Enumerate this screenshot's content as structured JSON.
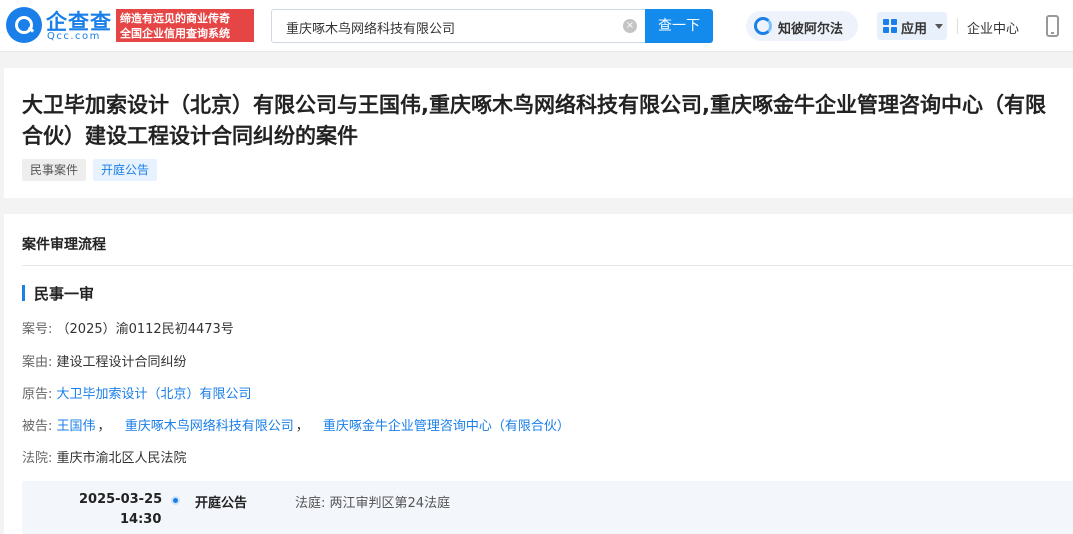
{
  "header": {
    "brand_name": "企查查",
    "brand_domain": "Qcc.com",
    "slogan_line1": "缔造有远见的商业传奇",
    "slogan_line2": "全国企业信用查询系统",
    "search_value": "重庆啄木鸟网络科技有限公司",
    "search_button": "查一下",
    "zhibo_label": "知彼阿尔法",
    "app_label": "应用",
    "enterprise_center": "企业中心",
    "clear_icon_glyph": "×"
  },
  "case": {
    "title": "大卫毕加索设计（北京）有限公司与王国伟,重庆啄木鸟网络科技有限公司,重庆啄金牛企业管理咨询中心（有限合伙）建设工程设计合同纠纷的案件",
    "tags": [
      "民事案件",
      "开庭公告"
    ]
  },
  "process": {
    "section_title": "案件审理流程",
    "stage_title": "民事一审",
    "case_no_label": "案号:",
    "case_no": "（2025）渝0112民初4473号",
    "cause_label": "案由:",
    "cause": "建设工程设计合同纠纷",
    "plaintiff_label": "原告:",
    "plaintiff": "大卫毕加索设计（北京）有限公司",
    "defendant_label": "被告:",
    "defendants": [
      "王国伟",
      "重庆啄木鸟网络科技有限公司",
      "重庆啄金牛企业管理咨询中心（有限合伙）"
    ],
    "defendant_separator": "，",
    "court_label": "法院:",
    "court": "重庆市渝北区人民法院"
  },
  "timeline": {
    "date": "2025-03-25",
    "time": "14:30",
    "event": "开庭公告",
    "court_room_label": "法庭:",
    "court_room": "两江审判区第24法庭"
  },
  "colors": {
    "accent": "#1a7fe8",
    "slogan_bg": "#e64545"
  }
}
